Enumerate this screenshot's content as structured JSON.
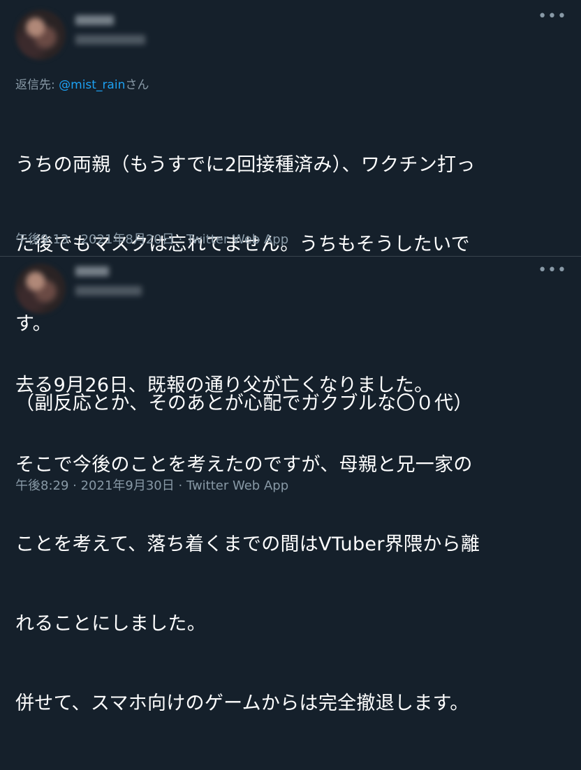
{
  "tweets": [
    {
      "reply_prefix": "返信先: ",
      "reply_handle": "@mist_rain",
      "reply_suffix": "さん",
      "lines": [
        "うちの両親（もうすでに2回接種済み）、ワクチン打っ",
        "た後でもマスクは忘れてません。うちもそうしたいで",
        "す。",
        "（副反応とか、そのあとが心配でガクブルな〇０代）"
      ],
      "time": "午後9:13",
      "date": "2021年8月20日",
      "source": "Twitter Web App"
    },
    {
      "lines": [
        "去る9月26日、既報の通り父が亡くなりました。",
        "そこで今後のことを考えたのですが、母親と兄一家の",
        "ことを考えて、落ち着くまでの間はVTuber界隈から離",
        "れることにしました。",
        "併せて、スマホ向けのゲームからは完全撤退します。"
      ],
      "time": "午後8:29",
      "date": "2021年9月30日",
      "source": "Twitter Web App"
    }
  ],
  "separator": " · ",
  "more_icon": "•••"
}
